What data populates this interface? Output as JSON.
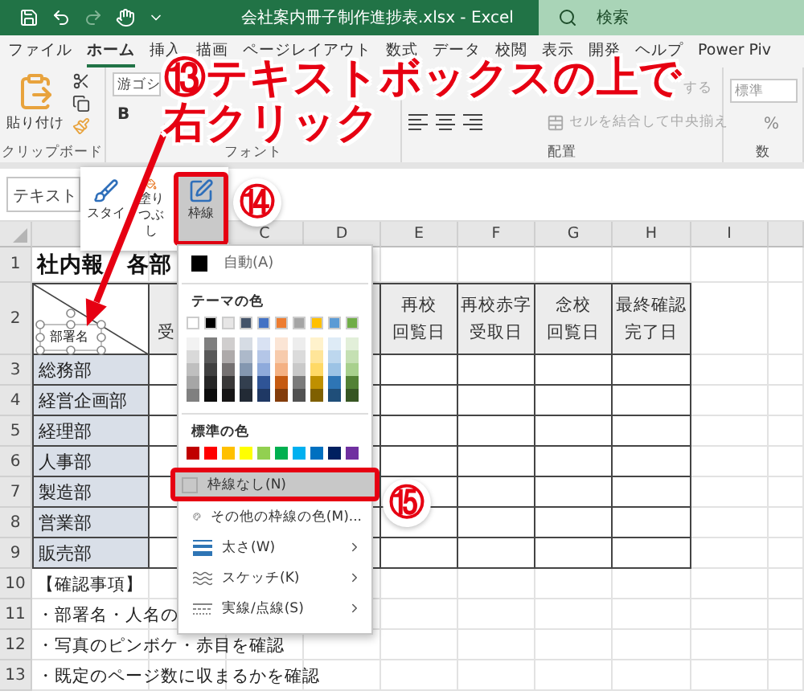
{
  "window": {
    "title": "会社案内冊子制作進捗表.xlsx  -  Excel",
    "search_placeholder": "検索"
  },
  "tabs": [
    {
      "label": "ファイル",
      "selected": false
    },
    {
      "label": "ホーム",
      "selected": true
    },
    {
      "label": "挿入",
      "selected": false
    },
    {
      "label": "描画",
      "selected": false
    },
    {
      "label": "ページレイアウト",
      "selected": false
    },
    {
      "label": "数式",
      "selected": false
    },
    {
      "label": "データ",
      "selected": false
    },
    {
      "label": "校閲",
      "selected": false
    },
    {
      "label": "表示",
      "selected": false
    },
    {
      "label": "開発",
      "selected": false
    },
    {
      "label": "ヘルプ",
      "selected": false
    },
    {
      "label": "Power Piv",
      "selected": false
    }
  ],
  "ribbon": {
    "groups": [
      {
        "kind": "clipboard",
        "label": "クリップボード",
        "paste": "貼り付け"
      },
      {
        "kind": "font",
        "label": "フォント",
        "font_name": "游ゴシ",
        "bold": "B"
      },
      {
        "kind": "alignment",
        "label": "配置",
        "wrap": "する",
        "merge": "セルを結合して中央揃え"
      },
      {
        "kind": "number",
        "label": "数",
        "format": "標準",
        "percent": "%"
      }
    ]
  },
  "formula_bar": {
    "name_box": "テキスト"
  },
  "mini_toolbar": {
    "buttons": [
      {
        "kind": "style",
        "label": "スタイ",
        "highlighted": false
      },
      {
        "kind": "fill",
        "label": "塗りつぶし",
        "highlighted": false
      },
      {
        "kind": "border",
        "label": "枠線",
        "highlighted": true
      }
    ]
  },
  "sheet": {
    "column_headers": [
      "C",
      "D",
      "E",
      "F",
      "G",
      "H",
      "I"
    ],
    "row_numbers": [
      "1",
      "2",
      "3",
      "4",
      "5",
      "6",
      "7",
      "8",
      "9",
      "10",
      "11",
      "12",
      "13"
    ],
    "title": "社内報　各部",
    "text_box": "部署名",
    "partial_header": "受",
    "header_cells": [
      {
        "lines": [
          "再校",
          "回覧日"
        ]
      },
      {
        "lines": [
          "再校赤字",
          "受取日"
        ]
      },
      {
        "lines": [
          "念校",
          "回覧日"
        ]
      },
      {
        "lines": [
          "最終確認",
          "完了日"
        ]
      }
    ],
    "departments": [
      "総務部",
      "経営企画部",
      "経理部",
      "人事部",
      "製造部",
      "営業部",
      "販売部"
    ],
    "notes": [
      "【確認事項】",
      "・部署名・人名の",
      "・写真のピンボケ・赤目を確認",
      "・既定のページ数に収まるかを確認"
    ]
  },
  "border_menu": {
    "auto": {
      "label": "自動(A)",
      "color": "#000000"
    },
    "theme_heading": "テーマの色",
    "theme_colors": [
      {
        "color": "#ffffff",
        "shades": [
          {
            "color": "#f2f2f2"
          },
          {
            "color": "#d9d9d9"
          },
          {
            "color": "#bfbfbf"
          },
          {
            "color": "#a6a6a6"
          },
          {
            "color": "#808080"
          }
        ]
      },
      {
        "color": "#000000",
        "shades": [
          {
            "color": "#7f7f7f"
          },
          {
            "color": "#595959"
          },
          {
            "color": "#404040"
          },
          {
            "color": "#262626"
          },
          {
            "color": "#0d0d0d"
          }
        ]
      },
      {
        "color": "#e7e6e6",
        "shades": [
          {
            "color": "#d0cece"
          },
          {
            "color": "#aeaaaa"
          },
          {
            "color": "#757171"
          },
          {
            "color": "#3a3838"
          },
          {
            "color": "#171616"
          }
        ]
      },
      {
        "color": "#44546a",
        "shades": [
          {
            "color": "#d6dce4"
          },
          {
            "color": "#adb9ca"
          },
          {
            "color": "#8497b0"
          },
          {
            "color": "#333f4f"
          },
          {
            "color": "#222a35"
          }
        ]
      },
      {
        "color": "#4472c4",
        "shades": [
          {
            "color": "#d9e2f3"
          },
          {
            "color": "#b4c6e7"
          },
          {
            "color": "#8eaadb"
          },
          {
            "color": "#2f5496"
          },
          {
            "color": "#1f3864"
          }
        ]
      },
      {
        "color": "#ed7d31",
        "shades": [
          {
            "color": "#fbe5d5"
          },
          {
            "color": "#f7cbac"
          },
          {
            "color": "#f4b183"
          },
          {
            "color": "#c55a11"
          },
          {
            "color": "#833c0b"
          }
        ]
      },
      {
        "color": "#a5a5a5",
        "shades": [
          {
            "color": "#ededed"
          },
          {
            "color": "#dbdbdb"
          },
          {
            "color": "#c9c9c9"
          },
          {
            "color": "#7b7b7b"
          },
          {
            "color": "#525252"
          }
        ]
      },
      {
        "color": "#ffc000",
        "shades": [
          {
            "color": "#fff2cc"
          },
          {
            "color": "#ffe599"
          },
          {
            "color": "#ffd966"
          },
          {
            "color": "#bf9000"
          },
          {
            "color": "#7f6000"
          }
        ]
      },
      {
        "color": "#5b9bd5",
        "shades": [
          {
            "color": "#deebf6"
          },
          {
            "color": "#bdd7ee"
          },
          {
            "color": "#9cc3e5"
          },
          {
            "color": "#2e75b5"
          },
          {
            "color": "#1f4e79"
          }
        ]
      },
      {
        "color": "#70ad47",
        "shades": [
          {
            "color": "#e2efd9"
          },
          {
            "color": "#c5e0b3"
          },
          {
            "color": "#a8d08d"
          },
          {
            "color": "#538135"
          },
          {
            "color": "#375623"
          }
        ]
      }
    ],
    "standard_heading": "標準の色",
    "standard_colors": [
      {
        "color": "#c00000"
      },
      {
        "color": "#ff0000"
      },
      {
        "color": "#ffc000"
      },
      {
        "color": "#ffff00"
      },
      {
        "color": "#92d050"
      },
      {
        "color": "#00b050"
      },
      {
        "color": "#00b0f0"
      },
      {
        "color": "#0070c0"
      },
      {
        "color": "#002060"
      },
      {
        "color": "#7030a0"
      }
    ],
    "items": [
      {
        "kind": "no-border",
        "label": "枠線なし(N)",
        "highlighted": true,
        "submenu": false
      },
      {
        "kind": "more-colors",
        "label": "その他の枠線の色(M)...",
        "highlighted": false,
        "submenu": false
      },
      {
        "kind": "weight",
        "label": "太さ(W)",
        "highlighted": false,
        "submenu": true
      },
      {
        "kind": "sketch",
        "label": "スケッチ(K)",
        "highlighted": false,
        "submenu": true
      },
      {
        "kind": "dash",
        "label": "実線/点線(S)",
        "highlighted": false,
        "submenu": true
      }
    ]
  },
  "callouts": [
    {
      "text": "⑬テキストボックスの上で"
    },
    {
      "text": "右クリック"
    }
  ],
  "step_badges": [
    "⑭",
    "⑮"
  ]
}
